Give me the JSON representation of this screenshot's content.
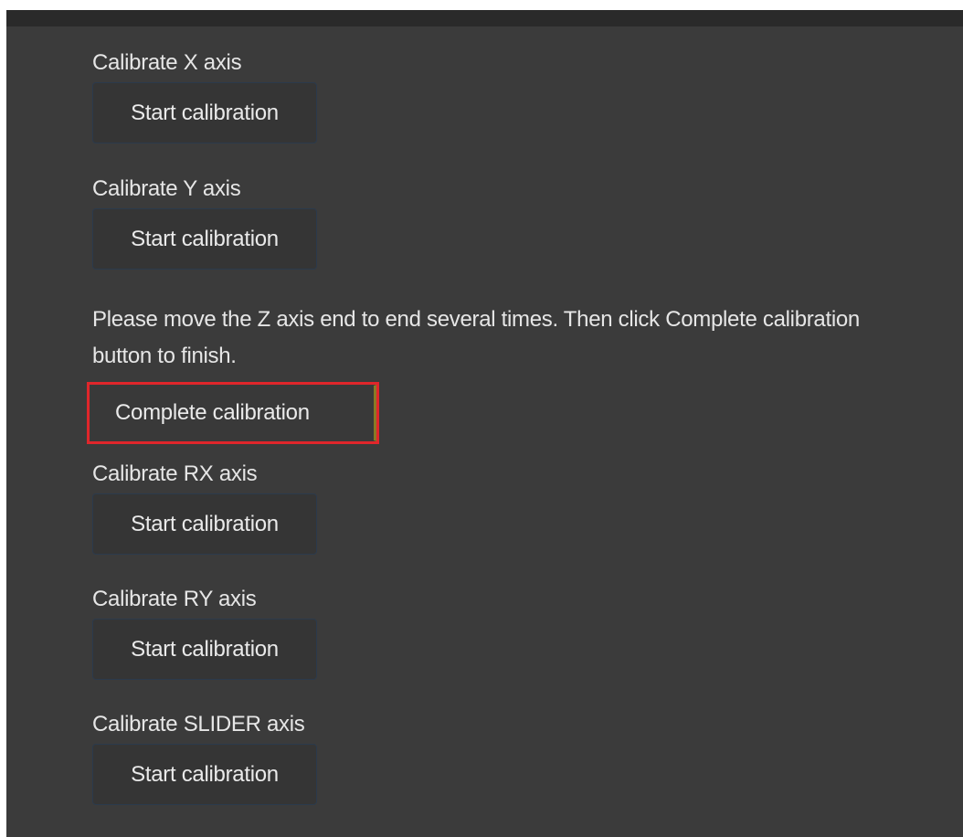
{
  "calibration": {
    "sections": [
      {
        "id": "x",
        "label": "Calibrate X axis",
        "button_label": "Start calibration"
      },
      {
        "id": "y",
        "label": "Calibrate Y axis",
        "button_label": "Start calibration"
      },
      {
        "id": "z",
        "message": "Please move the Z axis end to end several times. Then click Complete calibration button to finish.",
        "button_label": "Complete calibration"
      },
      {
        "id": "rx",
        "label": "Calibrate RX axis",
        "button_label": "Start calibration"
      },
      {
        "id": "ry",
        "label": "Calibrate RY axis",
        "button_label": "Start calibration"
      },
      {
        "id": "slider",
        "label": "Calibrate SLIDER axis",
        "button_label": "Start calibration"
      }
    ]
  },
  "colors": {
    "panel_background": "#3b3b3b",
    "top_bar": "#2a2a2a",
    "text": "#e6e6e6",
    "button_background": "#353535",
    "button_border": "#2b3a4c",
    "highlight_box": "#e0262b"
  }
}
